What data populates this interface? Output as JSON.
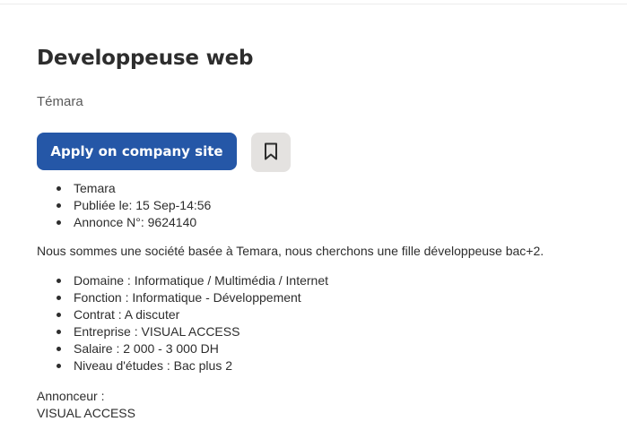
{
  "job": {
    "title": "Developpeuse web",
    "location": "Témara",
    "apply_label": "Apply on company site",
    "save_icon": "bookmark-icon",
    "accent_color": "#2557a7",
    "meta": [
      "Temara",
      "Publiée le: 15 Sep-14:56",
      "Annonce N°: 9624140"
    ],
    "description": "Nous sommes une société basée à Temara, nous cherchons une fille développeuse bac+2.",
    "details": [
      "Domaine : Informatique / Multimédia / Internet",
      "Fonction : Informatique - Développement",
      "Contrat : A discuter",
      "Entreprise : VISUAL ACCESS",
      "Salaire : 2 000 - 3 000 DH",
      "Niveau d'études : Bac plus 2"
    ],
    "advertiser_label": "Annonceur :",
    "advertiser_name": "VISUAL ACCESS"
  }
}
